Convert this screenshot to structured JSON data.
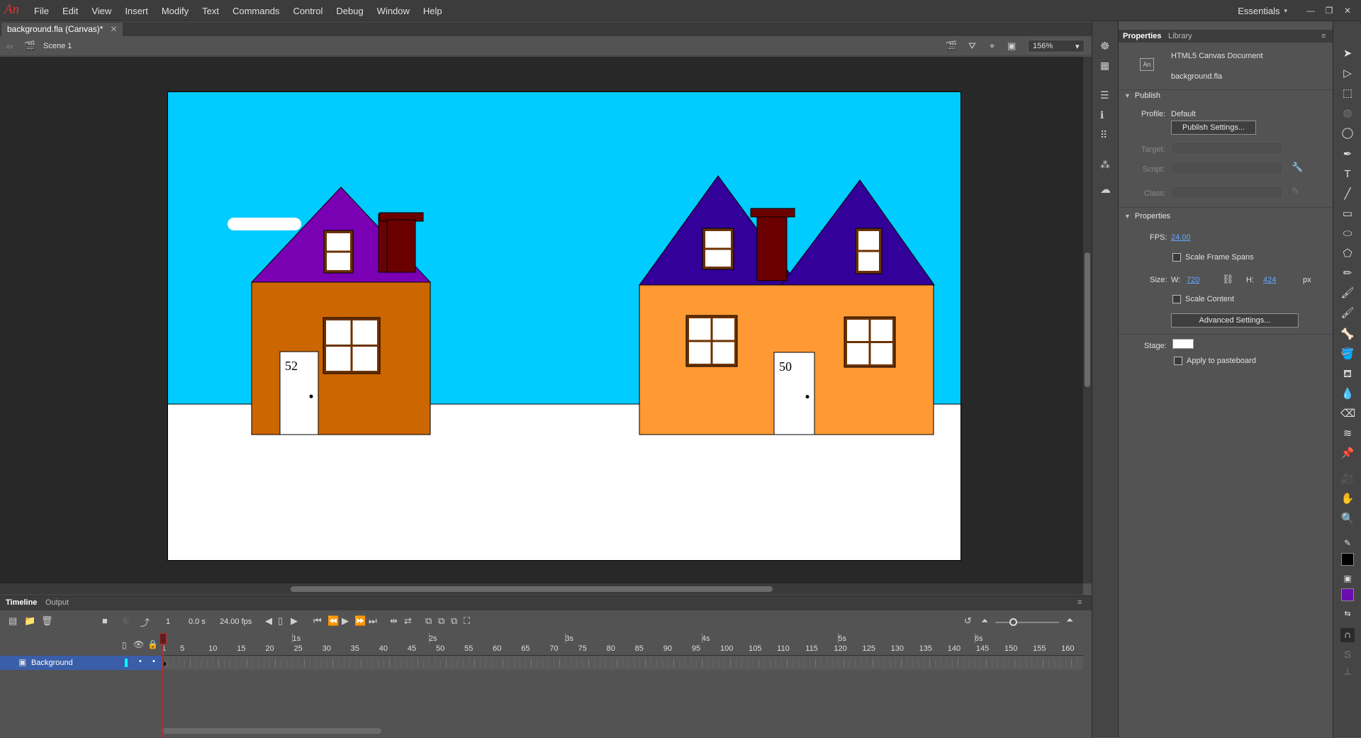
{
  "app": {
    "logo": "An",
    "menu": [
      "File",
      "Edit",
      "View",
      "Insert",
      "Modify",
      "Text",
      "Commands",
      "Control",
      "Debug",
      "Window",
      "Help"
    ],
    "workspace": "Essentials"
  },
  "document": {
    "tab_title": "background.fla (Canvas)*",
    "scene": "Scene 1",
    "zoom": "156%"
  },
  "stage": {
    "sky_color": "#00ccff",
    "ground_color": "#ffffff",
    "house_left": {
      "number": "52",
      "wall": "#cc6600",
      "roof": "#7a00b3"
    },
    "house_right": {
      "number": "50",
      "wall": "#ff9933",
      "roof": "#330099"
    },
    "chimney_color": "#6b0000"
  },
  "timeline": {
    "tabs": [
      "Timeline",
      "Output"
    ],
    "current_frame": "1",
    "time": "0.0 s",
    "fps": "24.00 fps",
    "seconds": [
      "1s",
      "2s",
      "3s",
      "4s",
      "5s",
      "6s"
    ],
    "frame_ticks": [
      "1",
      "5",
      "10",
      "15",
      "20",
      "25",
      "30",
      "35",
      "40",
      "45",
      "50",
      "55",
      "60",
      "65",
      "70",
      "75",
      "80",
      "85",
      "90",
      "95",
      "100",
      "105",
      "110",
      "115",
      "120",
      "125",
      "130",
      "135",
      "140",
      "145",
      "150",
      "155",
      "160"
    ],
    "layers": [
      {
        "name": "Background",
        "color": "#00ffff"
      }
    ]
  },
  "properties": {
    "tabs": [
      "Properties",
      "Library"
    ],
    "doc_type": "HTML5 Canvas Document",
    "doc_name": "background.fla",
    "publish_header": "Publish",
    "profile_label": "Profile:",
    "profile_value": "Default",
    "publish_settings": "Publish Settings...",
    "target_label": "Target:",
    "script_label": "Script:",
    "class_label": "Class:",
    "properties_header": "Properties",
    "fps_label": "FPS:",
    "fps_value": "24.00",
    "scale_frame_spans": "Scale Frame Spans",
    "size_label": "Size:",
    "w_label": "W:",
    "w_value": "720",
    "h_label": "H:",
    "h_value": "424",
    "unit": "px",
    "scale_content": "Scale Content",
    "advanced_settings": "Advanced Settings...",
    "stage_label": "Stage:",
    "stage_color": "#ffffff",
    "apply_pasteboard": "Apply to pasteboard"
  },
  "tools_panel": {
    "stroke_color": "#000000",
    "fill_color": "#6a0dad"
  }
}
